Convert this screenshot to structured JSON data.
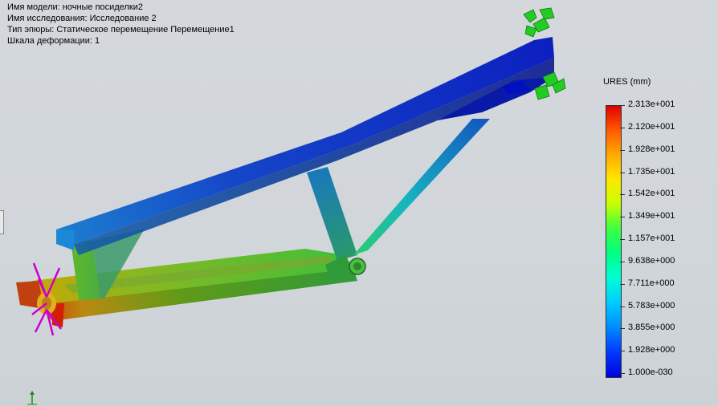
{
  "info": {
    "model_name": "Имя модели: ночные посиделки2",
    "study_name": "Имя  исследования: Исследование 2",
    "plot_type": "Тип эпюры: Статическое перемещение Перемещение1",
    "deformation_scale": "Шкала деформации: 1"
  },
  "legend": {
    "title": "URES (mm)",
    "labels": [
      "2.313e+001",
      "2.120e+001",
      "1.928e+001",
      "1.735e+001",
      "1.542e+001",
      "1.349e+001",
      "1.157e+001",
      "9.638e+000",
      "7.711e+000",
      "5.783e+000",
      "3.855e+000",
      "1.928e+000",
      "1.000e-030"
    ]
  },
  "icons": {
    "fixture": "fixture-arrows-icon",
    "load": "load-arrows-icon",
    "triad": "axis-triad-icon"
  },
  "colors": {
    "max": "#e00000",
    "min": "#0000e0",
    "fixture": "#22cc22",
    "load": "#cc00cc"
  }
}
